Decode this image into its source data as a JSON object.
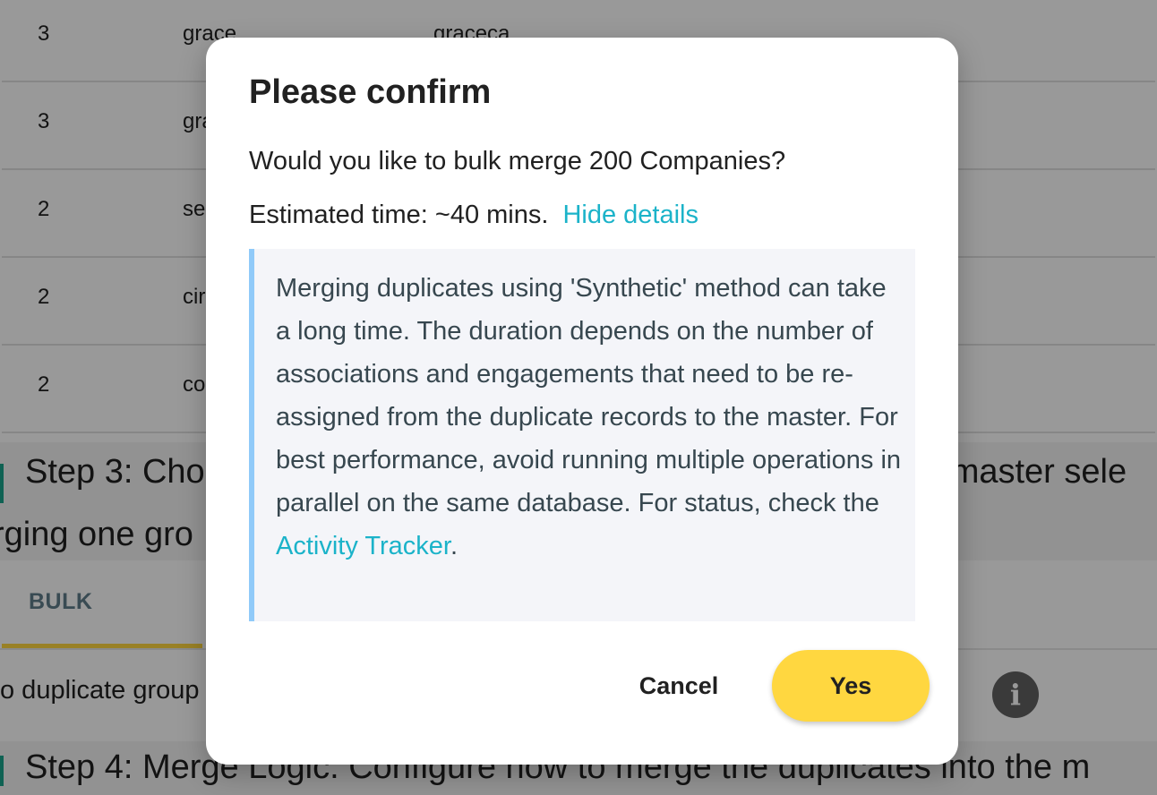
{
  "background": {
    "rows": [
      {
        "count": "3",
        "name": "grace",
        "value": "graceca"
      },
      {
        "count": "3",
        "name": "gra",
        "value": ""
      },
      {
        "count": "2",
        "name": "se",
        "value": ""
      },
      {
        "count": "2",
        "name": "cir",
        "value": ""
      },
      {
        "count": "2",
        "name": "co",
        "value": ""
      }
    ],
    "step3": {
      "line1_left": "Step 3: Cho",
      "line1_right": "g master sele",
      "line2": "rging one gro"
    },
    "tab_bulk": "BULK",
    "duplicate_text": "o duplicate group",
    "dot": ".",
    "info_icon_glyph": "i",
    "step4": "Step 4: Merge Logic. Configure how to merge the duplicates into the m"
  },
  "dialog": {
    "title": "Please confirm",
    "question": "Would you like to bulk merge 200 Companies?",
    "estimated_time": "Estimated time: ~40 mins.",
    "toggle_details": "Hide details",
    "details_text": "Merging duplicates using 'Synthetic' method can take a long time. The duration depends on the number of associations and engagements that need to be re-assigned from the duplicate records to the master. For best performance, avoid running multiple operations in parallel on the same database. For status, check the ",
    "details_link": "Activity Tracker",
    "details_end": ".",
    "cancel_label": "Cancel",
    "yes_label": "Yes"
  },
  "colors": {
    "accent_yellow": "#ffd740",
    "link": "#1bb3c9",
    "step_bar": "#1aa38a",
    "details_border": "#90caf9"
  }
}
